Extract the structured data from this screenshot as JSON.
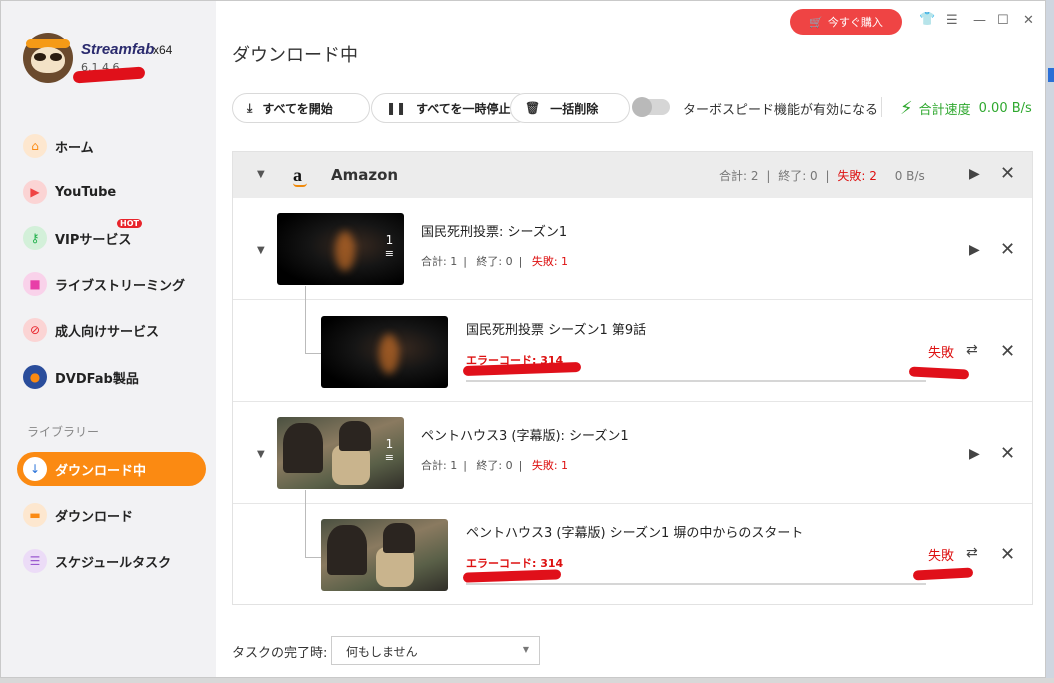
{
  "app": {
    "brand": "Streamfab",
    "arch": "x64",
    "version": "6.1.4.6"
  },
  "sidebar": {
    "items": [
      {
        "label": "ホーム",
        "icon": "home-icon",
        "color": "#fb8a12"
      },
      {
        "label": "YouTube",
        "icon": "youtube-icon",
        "color": "#ef4444"
      },
      {
        "label": "VIPサービス",
        "icon": "key-icon",
        "color": "#22b14c",
        "badge": "HOT"
      },
      {
        "label": "ライブストリーミング",
        "icon": "live-icon",
        "color": "#e83ea8"
      },
      {
        "label": "成人向けサービス",
        "icon": "adult-block-icon",
        "color": "#e8242b"
      },
      {
        "label": "DVDFab製品",
        "icon": "dvdfab-icon",
        "color": "#2a4d9b"
      }
    ],
    "library_label": "ライブラリー",
    "library": [
      {
        "label": "ダウンロード中",
        "icon": "download-arrow-icon",
        "active": true
      },
      {
        "label": "ダウンロード",
        "icon": "folder-icon",
        "color": "#fb8a12"
      },
      {
        "label": "スケジュールタスク",
        "icon": "schedule-icon",
        "color": "#9b59d0"
      }
    ]
  },
  "topbar": {
    "buy_label": "今すぐ購入",
    "buy_icon": "cart-icon"
  },
  "main": {
    "title": "ダウンロード中",
    "toolbar": {
      "start_all": "すべてを開始",
      "pause_all": "すべてを一時停止",
      "delete_all": "一括削除",
      "turbo_label": "ターボスピード機能が有効になる",
      "turbo_enabled": false,
      "speed_label": "合計速度",
      "speed_value": "0.00 B/s"
    },
    "group": {
      "name": "Amazon",
      "total_label": "合計: 2",
      "done_label": "終了: 0",
      "fail_label": "失敗: 2",
      "speed": "0 B/s"
    },
    "series": [
      {
        "title": "国民死刑投票: シーズン1",
        "count": "1",
        "total": "合計: 1",
        "done": "終了: 0",
        "fail": "失敗: 1",
        "episode": {
          "title": "国民死刑投票 シーズン1 第9話",
          "error": "エラーコード: 314",
          "status": "失敗"
        }
      },
      {
        "title": "ペントハウス3 (字幕版): シーズン1",
        "count": "1",
        "total": "合計: 1",
        "done": "終了: 0",
        "fail": "失敗: 1",
        "episode": {
          "title": "ペントハウス3 (字幕版) シーズン1 塀の中からのスタート",
          "error": "エラーコード: 314",
          "status": "失敗"
        }
      }
    ],
    "footer": {
      "label": "タスクの完了時:",
      "select_value": "何もしません"
    }
  }
}
